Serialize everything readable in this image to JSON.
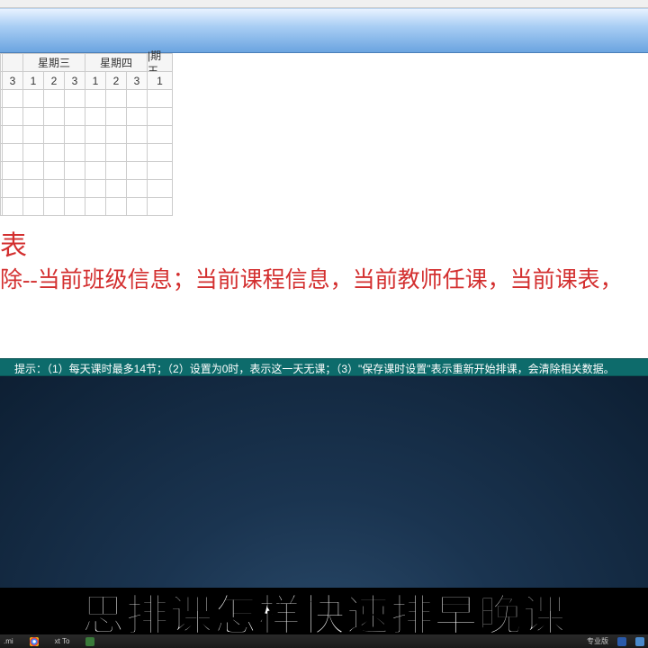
{
  "table": {
    "day_headers": [
      "",
      "星期三",
      "星期四",
      "|期王"
    ],
    "num_headers": [
      "",
      "3",
      "1",
      "2",
      "3",
      "1",
      "2",
      "3",
      "1"
    ]
  },
  "red_block": {
    "line1": "表",
    "line2": "除--当前班级信息；当前课程信息，当前教师任课，当前课表，"
  },
  "hint": "提示：（1）每天课时最多14节；（2）设置为0时，表示这一天无课；（3）\"保存课时设置\"表示重新开始排课，会清除相关数据。",
  "caption": "思排课怎样快速排早晚课",
  "taskbar": {
    "left_items": [
      ".mi",
      "xt To"
    ],
    "right_items": [
      "专业版"
    ]
  }
}
